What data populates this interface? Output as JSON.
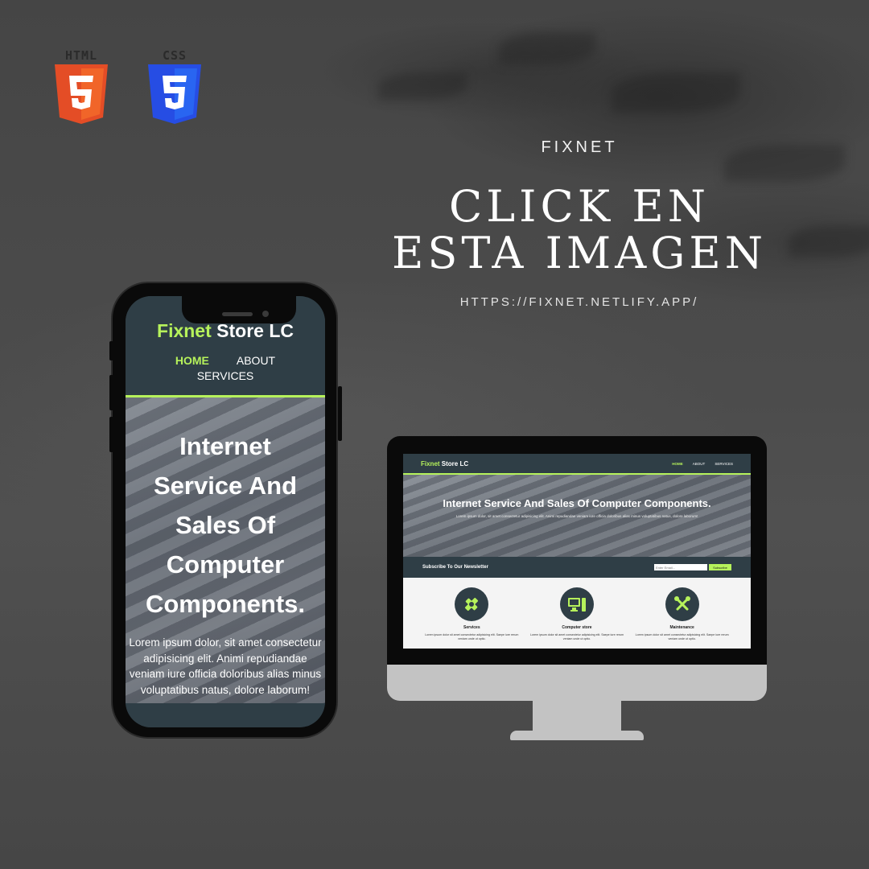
{
  "logos": [
    {
      "label": "HTML",
      "icon": "html5-icon",
      "color": "#e44d26"
    },
    {
      "label": "CSS",
      "icon": "css3-icon",
      "color": "#264de4"
    }
  ],
  "heading": {
    "brand": "FIXNET",
    "title": "CLICK EN ESTA IMAGEN",
    "url": "HTTPS://FIXNET.NETLIFY.APP/"
  },
  "site": {
    "brand_accent": "Fixnet",
    "brand_rest": " Store LC",
    "nav": {
      "home": "HOME",
      "about": "ABOUT",
      "services": "SERVICES"
    },
    "hero_title_mobile": "Internet Service And Sales Of Computer Components.",
    "hero_title_desktop": "Internet Service And Sales Of Computer Components.",
    "hero_text": "Lorem ipsum dolor, sit amet consectetur adipisicing elit. Animi repudiandae veniam iure officia doloribus alias minus voluptatibus natus, dolore laborum!",
    "newsletter": {
      "label": "Subscribe To Our Newsletter",
      "placeholder": "Enter Email...",
      "button": "Subscribe"
    },
    "services": [
      {
        "title": "Services",
        "icon": "satellite-icon",
        "text": "Lorem ipsum dolor sit amet consectetur adipisicing elit. Saepe iure rerum veniam unde ut optio."
      },
      {
        "title": "Computer store",
        "icon": "computer-icon",
        "text": "Lorem ipsum dolor sit amet consectetur adipisicing elit. Saepe iure rerum veniam unde ut optio."
      },
      {
        "title": "Maintenance",
        "icon": "tools-icon",
        "text": "Lorem ipsum dolor sit amet consectetur adipisicing elit. Saepe iure rerum veniam unde ut optio."
      }
    ]
  },
  "colors": {
    "accent": "#b6f25b",
    "header_bg": "#2f3e46",
    "background": "#4a4a4a"
  }
}
